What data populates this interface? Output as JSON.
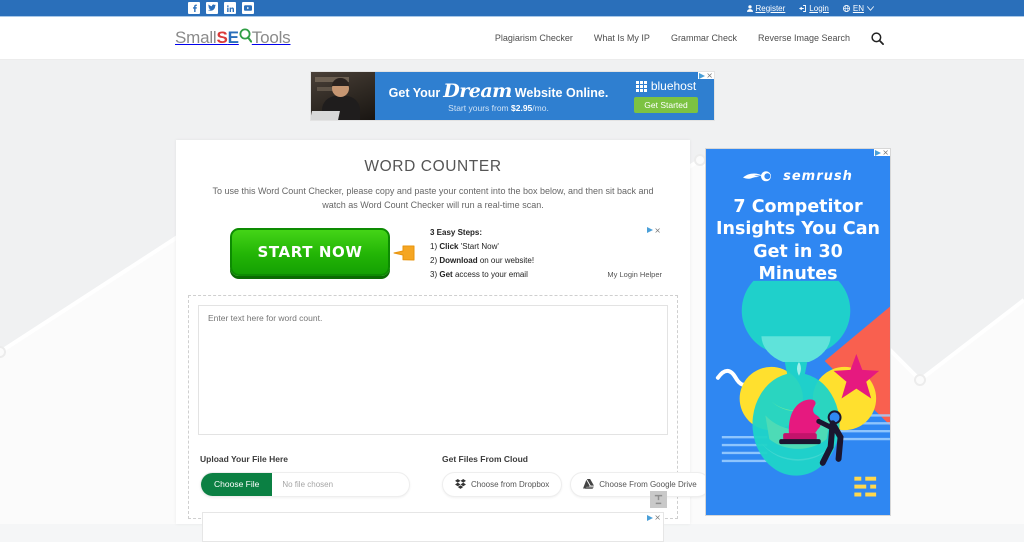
{
  "topbar": {
    "social": [
      {
        "name": "facebook-icon",
        "label": "Facebook"
      },
      {
        "name": "twitter-icon",
        "label": "Twitter"
      },
      {
        "name": "linkedin-icon",
        "label": "LinkedIn"
      },
      {
        "name": "youtube-icon",
        "label": "YouTube"
      }
    ],
    "register_label": "Register",
    "login_label": "Login",
    "language_label": "EN",
    "bg_color": "#2a6fba"
  },
  "header": {
    "logo": {
      "part1": "Small",
      "s": "S",
      "e": "E",
      "o": "O",
      "part2": "Tools"
    },
    "nav": [
      {
        "label": "Plagiarism Checker"
      },
      {
        "label": "What Is My IP"
      },
      {
        "label": "Grammar Check"
      },
      {
        "label": "Reverse Image Search"
      }
    ],
    "search_icon": "search-icon"
  },
  "banner_ad": {
    "line1_prefix": "Get Your",
    "line1_script": "Dream",
    "line1_suffix": "Website Online.",
    "line2_prefix": "Start yours from",
    "line2_price": "$2.95",
    "line2_suffix": "/mo.",
    "brand": "bluehost",
    "cta": "Get Started",
    "close_label": "×",
    "brand_bg": "#2f7fd0",
    "cta_bg": "#7cc242"
  },
  "main": {
    "title": "WORD COUNTER",
    "description": "To use this Word Count Checker, please copy and paste your content into the box below, and then sit back and watch as Word Count Checker will run a real-time scan.",
    "inline_ad": {
      "button_label": "START NOW",
      "steps_heading": "3 Easy Steps:",
      "step1_num": "1)",
      "step1_bold": "Click",
      "step1_rest": "'Start Now'",
      "step2_num": "2)",
      "step2_bold": "Download",
      "step2_rest": "on our website!",
      "step3_num": "3)",
      "step3_bold": "Get",
      "step3_rest": "access to your email",
      "advertiser": "My Login Helper",
      "close_label": "×"
    },
    "textarea": {
      "placeholder": "Enter text here for word count.",
      "value": "",
      "handle_icon": "resize-handle-icon"
    },
    "upload": {
      "label": "Upload Your File Here",
      "choose_file_label": "Choose File",
      "file_name": "No file chosen",
      "button_color": "#0b8043"
    },
    "cloud": {
      "label": "Get Files From Cloud",
      "dropbox_label": "Choose from Dropbox",
      "gdrive_label": "Choose From Google Drive"
    },
    "bottom_ad": {
      "close_label": "×"
    }
  },
  "side_ad": {
    "brand": "semrush",
    "headline": "7 Competitor Insights You Can Get in 30 Minutes",
    "close_label": "×",
    "bg_color": "#2f87f2"
  }
}
